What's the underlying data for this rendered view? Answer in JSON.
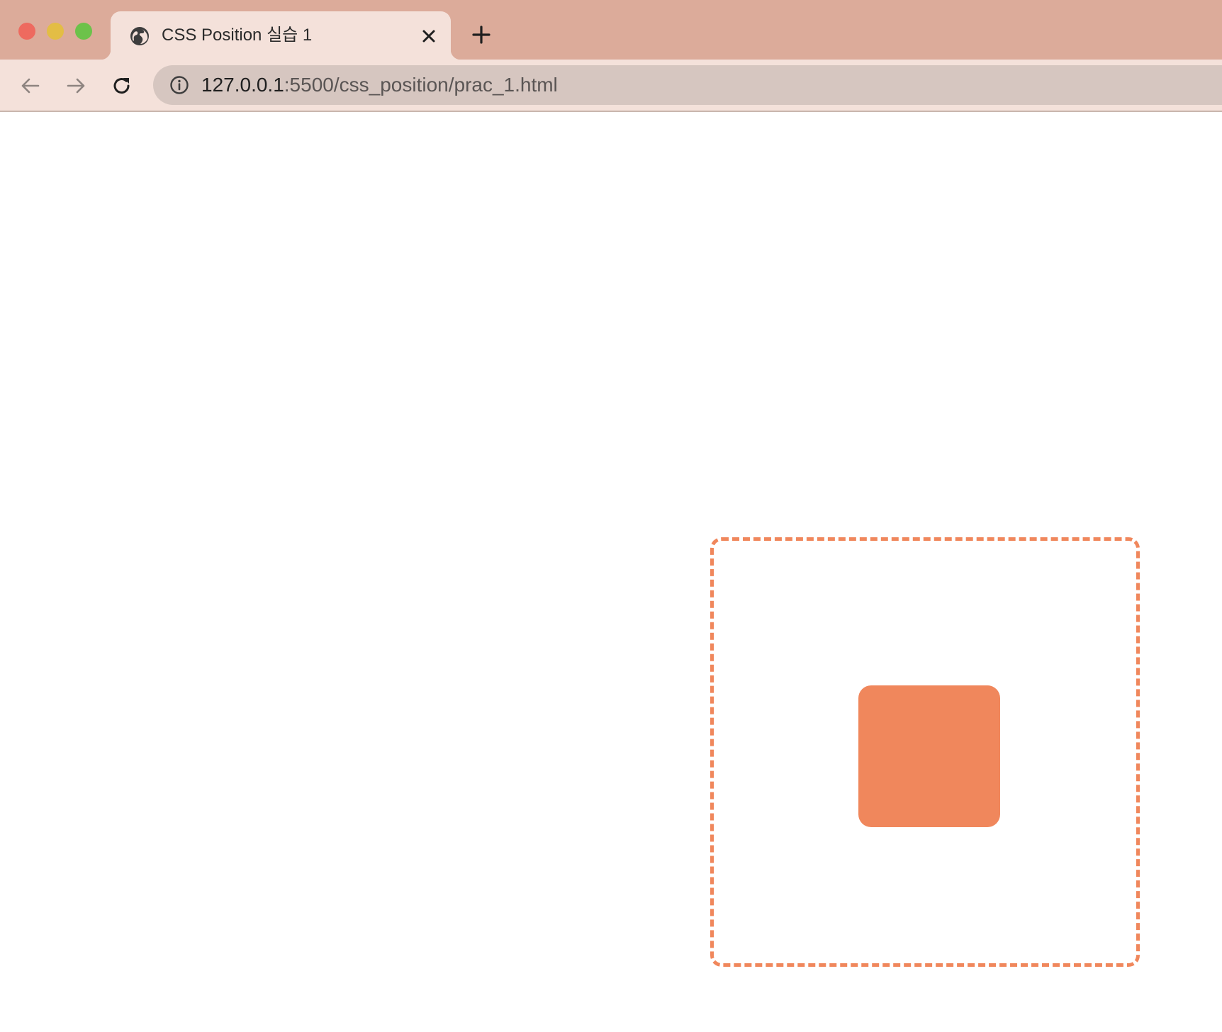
{
  "browser": {
    "window_controls": {
      "close_color": "#ee6a5f",
      "minimize_color": "#e3bd45",
      "maximize_color": "#6cc24a"
    },
    "tab": {
      "title": "CSS Position 실습 1",
      "favicon": "globe-icon",
      "close_icon": "close-icon"
    },
    "new_tab_icon": "plus-icon",
    "toolbar": {
      "back_icon": "arrow-left-icon",
      "forward_icon": "arrow-right-icon",
      "reload_icon": "reload-icon",
      "security_icon": "info-icon",
      "url_host": "127.0.0.1",
      "url_rest": ":5500/css_position/prac_1.html"
    },
    "theme": {
      "tabstrip_color": "#dcab9a",
      "toolbar_color": "#f4e1da",
      "omnibox_color": "#d6c6c0"
    }
  },
  "page": {
    "accent_color": "#f0875c",
    "outer_box": {
      "border_style": "dashed"
    },
    "inner_box": {
      "fill": "solid"
    }
  }
}
